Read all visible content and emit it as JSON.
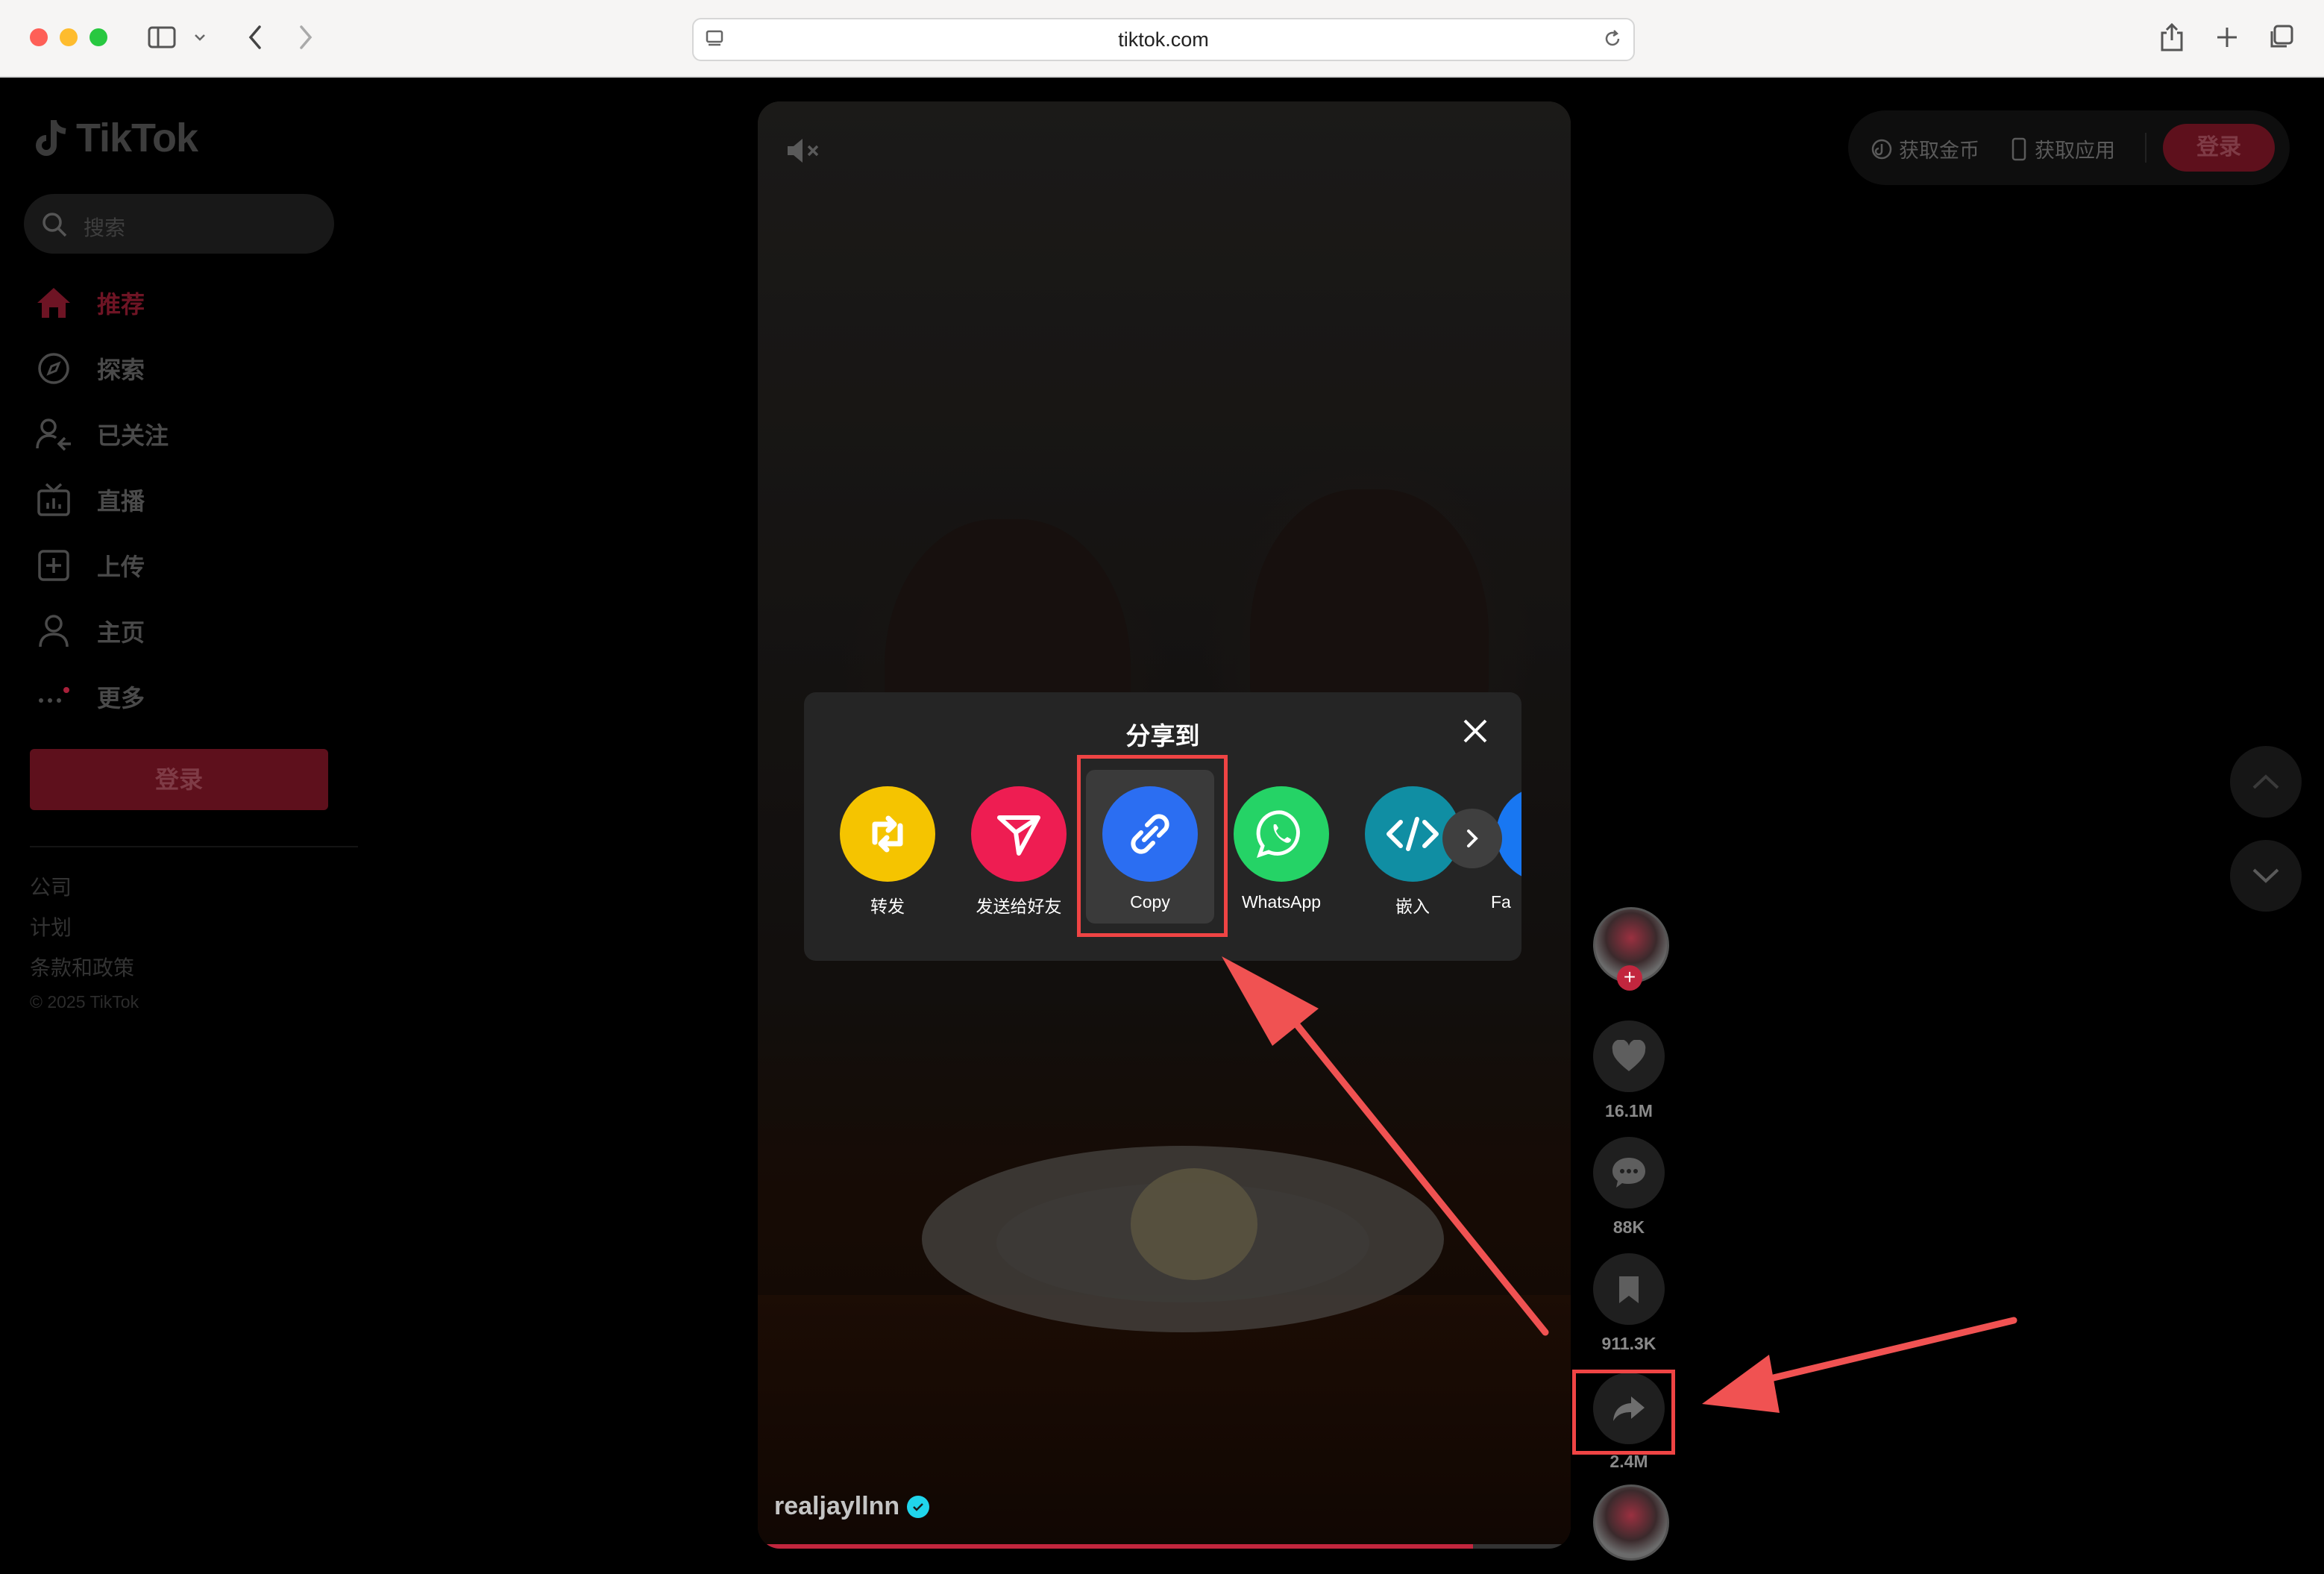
{
  "browser": {
    "url": "tiktok.com",
    "icons": [
      "sidebar-toggle-icon",
      "chevron-down-icon",
      "back-icon",
      "forward-icon",
      "page-menu-icon",
      "reload-icon",
      "share-icon",
      "new-tab-icon",
      "tabs-overview-icon"
    ]
  },
  "sidebar": {
    "logo_text": "TikTok",
    "search_placeholder": "搜索",
    "nav": [
      {
        "label": "推荐",
        "icon": "home-icon",
        "active": true
      },
      {
        "label": "探索",
        "icon": "compass-icon",
        "active": false
      },
      {
        "label": "已关注",
        "icon": "following-icon",
        "active": false
      },
      {
        "label": "直播",
        "icon": "live-tv-icon",
        "active": false
      },
      {
        "label": "上传",
        "icon": "upload-icon",
        "active": false
      },
      {
        "label": "主页",
        "icon": "profile-icon",
        "active": false
      },
      {
        "label": "更多",
        "icon": "more-dots-icon",
        "active": false
      }
    ],
    "login_button": "登录",
    "footer_links": [
      "公司",
      "计划",
      "条款和政策"
    ],
    "copyright": "© 2025 TikTok"
  },
  "topbar": {
    "get_coins": "获取金币",
    "get_app": "获取应用",
    "login": "登录"
  },
  "video": {
    "creator": "realjayllnn",
    "verified": true,
    "progress": 0.88
  },
  "actions": {
    "likes": "16.1M",
    "comments": "88K",
    "bookmarks": "911.3K",
    "shares": "2.4M"
  },
  "share_modal": {
    "title": "分享到",
    "items": [
      {
        "label": "转发",
        "icon": "repost-icon",
        "color": "#f5c400"
      },
      {
        "label": "发送给好友",
        "icon": "send-icon",
        "color": "#ee1d52"
      },
      {
        "label": "Copy",
        "icon": "link-icon",
        "color": "#2b6ef2"
      },
      {
        "label": "WhatsApp",
        "icon": "whatsapp-icon",
        "color": "#25d366"
      },
      {
        "label": "嵌入",
        "icon": "embed-icon",
        "color": "#108ea3"
      },
      {
        "label": "Fa",
        "icon": "facebook-icon",
        "color": "#1877f2"
      }
    ]
  },
  "colors": {
    "annotation": "#ef4444",
    "brand_red": "#c2263e"
  }
}
